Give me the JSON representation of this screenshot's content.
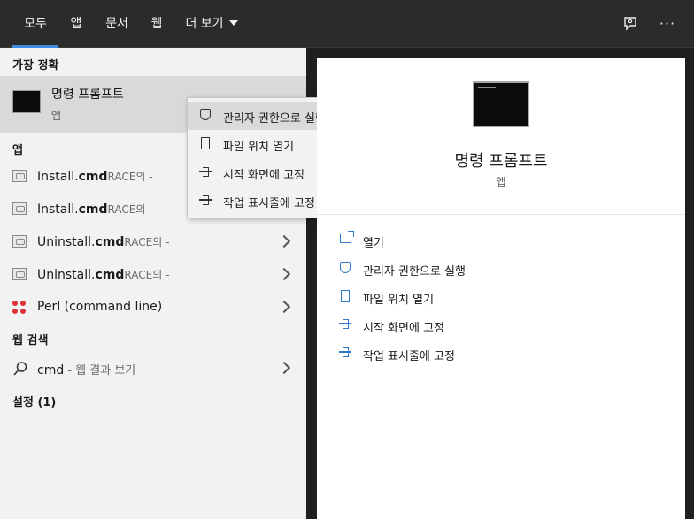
{
  "tabs": [
    {
      "label": "모두",
      "active": true
    },
    {
      "label": "앱",
      "active": false
    },
    {
      "label": "문서",
      "active": false
    },
    {
      "label": "웹",
      "active": false
    },
    {
      "label": "더 보기",
      "active": false
    }
  ],
  "accent_color": "#3d8be0",
  "sections": {
    "best_match": "가장 정확",
    "apps": "앱",
    "web_search": "웹 검색",
    "settings": "설정 (1)"
  },
  "best_match_item": {
    "title": "명령 프롬프트",
    "subtitle": "앱"
  },
  "app_results": [
    {
      "prefix": "Install.",
      "bold": "cmd",
      "suffix": "RACE의 -",
      "has_chevron": false
    },
    {
      "prefix": "Install.",
      "bold": "cmd",
      "suffix": "RACE의 -",
      "has_chevron": false
    },
    {
      "prefix": "Uninstall.",
      "bold": "cmd",
      "suffix": "RACE의 -",
      "has_chevron": true
    },
    {
      "prefix": "Uninstall.",
      "bold": "cmd",
      "suffix": "RACE의 -",
      "has_chevron": true
    }
  ],
  "perl_item": {
    "label": "Perl (command line)"
  },
  "web_search_item": {
    "query": "cmd",
    "suffix": " - 웹 결과 보기"
  },
  "context_menu": [
    {
      "label": "관리자 권한으로 실행",
      "icon": "shield-icon",
      "highlighted": true
    },
    {
      "label": "파일 위치 열기",
      "icon": "file-location-icon",
      "highlighted": false
    },
    {
      "label": "시작 화면에 고정",
      "icon": "pin-icon",
      "highlighted": false
    },
    {
      "label": "작업 표시줄에 고정",
      "icon": "pin-icon",
      "highlighted": false
    }
  ],
  "detail": {
    "title": "명령 프롬프트",
    "subtitle": "앱",
    "actions": [
      {
        "label": "열기",
        "icon": "open-icon"
      },
      {
        "label": "관리자 권한으로 실행",
        "icon": "shield-icon"
      },
      {
        "label": "파일 위치 열기",
        "icon": "file-location-icon"
      },
      {
        "label": "시작 화면에 고정",
        "icon": "pin-icon"
      },
      {
        "label": "작업 표시줄에 고정",
        "icon": "pin-icon"
      }
    ]
  }
}
